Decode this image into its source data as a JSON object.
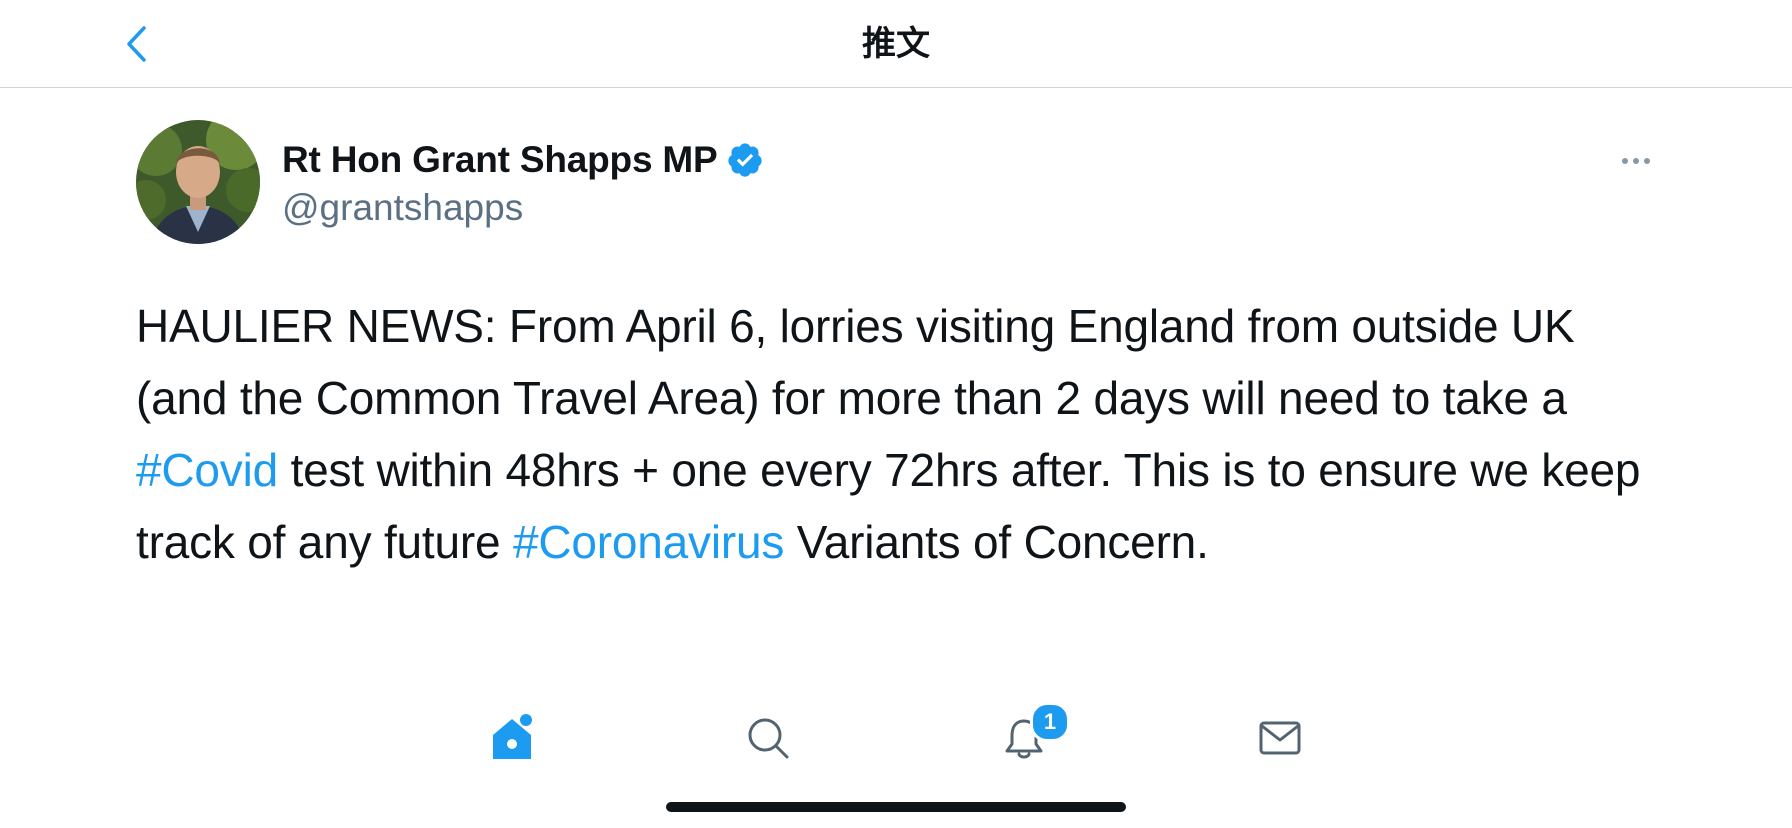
{
  "header": {
    "title": "推文",
    "back_icon": "chevron-left-icon"
  },
  "tweet": {
    "display_name": "Rt Hon Grant Shapps MP",
    "handle": "@grantshapps",
    "verified": true,
    "avatar_alt": "avatar",
    "more_icon": "more-horizontal-icon",
    "text_parts": {
      "p1": "HAULIER NEWS: From April 6, lorries visiting England from outside UK (and the Common Travel Area) for more than 2 days will need to take a ",
      "hashtag1": "#Covid",
      "p2": " test within 48hrs + one every 72hrs after. This is to ensure we keep track of any future ",
      "hashtag2": "#Coronavirus",
      "p3": " Variants of Concern."
    }
  },
  "tabbar": {
    "items": [
      {
        "name": "home",
        "icon": "home-icon",
        "active": true
      },
      {
        "name": "search",
        "icon": "search-icon",
        "active": false
      },
      {
        "name": "notifications",
        "icon": "bell-icon",
        "active": false,
        "badge": "1"
      },
      {
        "name": "messages",
        "icon": "mail-icon",
        "active": false
      }
    ]
  },
  "colors": {
    "accent": "#1d9bf0",
    "text": "#0f1419",
    "secondary_text": "#5b7083",
    "divider": "#cfd4d8"
  }
}
